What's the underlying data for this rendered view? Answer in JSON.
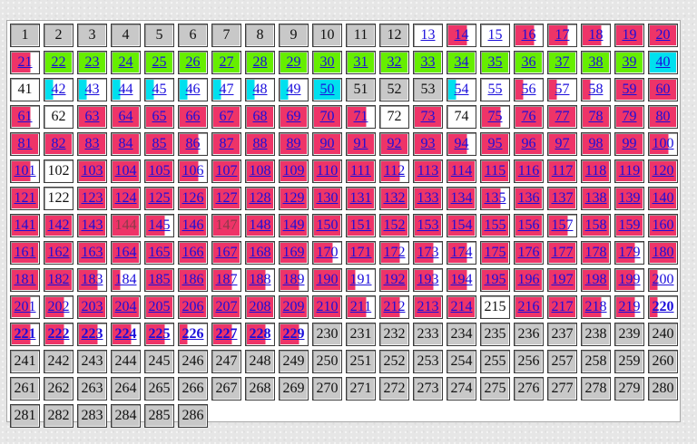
{
  "colors": {
    "gray": "#c8c8c8",
    "pink": "#ee3468",
    "green": "#66ee00",
    "cyan": "#00e0ee",
    "white": "#ffffff",
    "link": "#1a0ddb"
  },
  "grid": {
    "rows": [
      [
        "g1",
        "g2",
        "g3",
        "g4",
        "g5",
        "g6",
        "g7",
        "g8",
        "g9",
        "g10",
        "g11",
        "g12",
        "w13l",
        "P14l",
        "w15l",
        "P16l",
        "P17l",
        "P18l",
        "p19l",
        "p20l"
      ],
      [
        "P21l",
        "G22l",
        "G23l",
        "G24l",
        "G25l",
        "G26l",
        "G27l",
        "G28l",
        "G29l",
        "G30l",
        "G31l",
        "G32l",
        "G33l",
        "G34l",
        "G35l",
        "G36l",
        "G37l",
        "G38l",
        "G39l",
        "c40l"
      ],
      [
        "w41",
        "C42l",
        "C43l",
        "C44l",
        "C45l",
        "C46l",
        "C47l",
        "C48l",
        "C49l",
        "c50l",
        "g51",
        "g52",
        "g53",
        "C54l",
        "w55l",
        "W56l",
        "W57l",
        "W58l",
        "p59l",
        "p60l"
      ],
      [
        "P61l",
        "w62",
        "p63l",
        "p64l",
        "p65l",
        "p66l",
        "p67l",
        "p68l",
        "p69l",
        "p70l",
        "P71l",
        "w72",
        "p73l",
        "w74",
        "P75l",
        "p76l",
        "p77l",
        "p78l",
        "p79l",
        "p80l"
      ],
      [
        "p81l",
        "p82l",
        "p83l",
        "p84l",
        "p85l",
        "P86l",
        "p87l",
        "p88l",
        "p89l",
        "p90l",
        "p91l",
        "p92l",
        "p93l",
        "P94l",
        "p95l",
        "p96l",
        "p97l",
        "p98l",
        "p99l",
        "P100l"
      ],
      [
        "P101l",
        "w102",
        "p103l",
        "p104l",
        "p105l",
        "P106l",
        "p107l",
        "p108l",
        "p109l",
        "p110l",
        "p111l",
        "P112l",
        "p113l",
        "p114l",
        "p115l",
        "p116l",
        "p117l",
        "p118l",
        "p119l",
        "p120l"
      ],
      [
        "p121l",
        "w122",
        "p123l",
        "p124l",
        "p125l",
        "p126l",
        "p127l",
        "p128l",
        "p129l",
        "p130l",
        "p131l",
        "p132l",
        "p133l",
        "p134l",
        "P135l",
        "p136l",
        "p137l",
        "p138l",
        "p139l",
        "p140l"
      ],
      [
        "p141l",
        "p142l",
        "p143l",
        "p144d",
        "P145l",
        "p146l",
        "p147d",
        "p148l",
        "p149l",
        "p150l",
        "p151l",
        "p152l",
        "p153l",
        "p154l",
        "p155l",
        "p156l",
        "P157l",
        "p158l",
        "p159l",
        "p160l"
      ],
      [
        "p161l",
        "p162l",
        "p163l",
        "p164l",
        "p165l",
        "p166l",
        "p167l",
        "p168l",
        "p169l",
        "P170l",
        "p171l",
        "P172l",
        "P173l",
        "P174l",
        "p175l",
        "p176l",
        "p177l",
        "p178l",
        "P179l",
        "p180l"
      ],
      [
        "p181l",
        "p182l",
        "P183l",
        "W184l",
        "p185l",
        "p186l",
        "P187l",
        "P188l",
        "P189l",
        "p190l",
        "W191l",
        "p192l",
        "P193l",
        "P194l",
        "p195l",
        "p196l",
        "p197l",
        "p198l",
        "P199l",
        "W200l"
      ],
      [
        "P201l",
        "P202l",
        "p203l",
        "p204l",
        "p205l",
        "p206l",
        "p207l",
        "p208l",
        "p209l",
        "p210l",
        "P211l",
        "P212l",
        "p213l",
        "p214l",
        "w215",
        "p216l",
        "p217l",
        "P218l",
        "P219l",
        "W220b"
      ],
      [
        "P221b",
        "P222b",
        "P223b",
        "P224b",
        "P225b",
        "W226b",
        "P227b",
        "P228b",
        "P229b",
        "g230",
        "g231",
        "g232",
        "g233",
        "g234",
        "g235",
        "g236",
        "g237",
        "g238",
        "g239",
        "g240"
      ],
      [
        "g241",
        "g242",
        "g243",
        "g244",
        "g245",
        "g246",
        "g247",
        "g248",
        "g249",
        "g250",
        "g251",
        "g252",
        "g253",
        "g254",
        "g255",
        "g256",
        "g257",
        "g258",
        "g259",
        "g260"
      ],
      [
        "g261",
        "g262",
        "g263",
        "g264",
        "g265",
        "g266",
        "g267",
        "g268",
        "g269",
        "g270",
        "g271",
        "g272",
        "g273",
        "g274",
        "g275",
        "g276",
        "g277",
        "g278",
        "g279",
        "g280"
      ],
      [
        "g281",
        "g282",
        "g283",
        "g284",
        "g285",
        "g286"
      ]
    ]
  }
}
